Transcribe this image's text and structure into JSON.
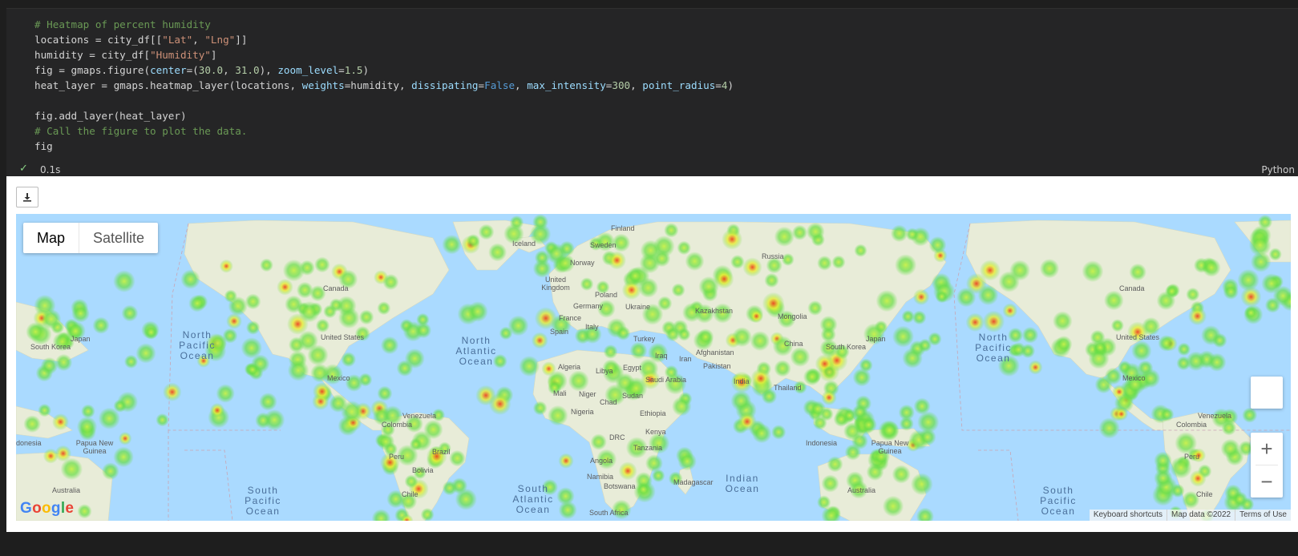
{
  "code": {
    "line1": "# Heatmap of percent humidity",
    "line2": {
      "a": "locations = city_df[[",
      "s1": "\"Lat\"",
      "b": ", ",
      "s2": "\"Lng\"",
      "c": "]]"
    },
    "line3": {
      "a": "humidity = city_df[",
      "s1": "\"Humidity\"",
      "b": "]"
    },
    "line4": {
      "a": "fig = gmaps.figure(",
      "k1": "center",
      "b": "=(",
      "n1": "30.0",
      "c": ", ",
      "n2": "31.0",
      "d": "), ",
      "k2": "zoom_level",
      "e": "=",
      "n3": "1.5",
      "f": ")"
    },
    "line5": {
      "a": "heat_layer = gmaps.heatmap_layer(locations, ",
      "k1": "weights",
      "b": "=humidity, ",
      "k2": "dissipating",
      "c": "=",
      "v1": "False",
      "d": ", ",
      "k3": "max_intensity",
      "e": "=",
      "n1": "300",
      "f": ", ",
      "k4": "point_radius",
      "g": "=",
      "n2": "4",
      "h": ")"
    },
    "line7": "fig.add_layer(heat_layer)",
    "line8": "# Call the figure to plot the data.",
    "line9": "fig"
  },
  "status": {
    "check_icon": "check-icon",
    "time": "0.1s",
    "language": "Python"
  },
  "output": {
    "download_icon": "download-icon",
    "map_type": {
      "map": "Map",
      "satellite": "Satellite"
    },
    "zoom_in": "+",
    "zoom_out": "−",
    "logo": "Google",
    "attribution": {
      "shortcuts": "Keyboard shortcuts",
      "data": "Map data ©2022",
      "terms": "Terms of Use"
    },
    "oceans": {
      "north_pacific_1": [
        "North",
        "Pacific",
        "Ocean"
      ],
      "north_atlantic": [
        "North",
        "Atlantic",
        "Ocean"
      ],
      "north_pacific_2": [
        "North",
        "Pacific",
        "Ocean"
      ],
      "south_pacific_1": [
        "South",
        "Pacific",
        "Ocean"
      ],
      "south_atlantic": [
        "South",
        "Atlantic",
        "Ocean"
      ],
      "indian": [
        "Indian",
        "Ocean"
      ],
      "south_pacific_2": [
        "South",
        "Pacific",
        "Ocean"
      ]
    },
    "countries": {
      "finland": "Finland",
      "sweden": "Sweden",
      "iceland": "Iceland",
      "norway": "Norway",
      "russia": "Russia",
      "canada_1": "Canada",
      "canada_2": "Canada",
      "united_kingdom": [
        "United",
        "Kingdom"
      ],
      "poland": "Poland",
      "germany": "Germany",
      "ukraine": "Ukraine",
      "kazakhstan": "Kazakhstan",
      "mongolia": "Mongolia",
      "france": "France",
      "spain": "Spain",
      "italy": "Italy",
      "turkey": "Turkey",
      "japan_1": "Japan",
      "japan_2": "Japan",
      "south_korea_1": "South Korea",
      "south_korea_2": "South Korea",
      "united_states_1": "United States",
      "united_states_2": "United States",
      "china": "China",
      "iraq": "Iraq",
      "iran": "Iran",
      "afghanistan": "Afghanistan",
      "pakistan": "Pakistan",
      "algeria": "Algeria",
      "libya": "Libya",
      "egypt": "Egypt",
      "saudi_arabia": "Saudi Arabia",
      "india": "India",
      "mexico_1": "Mexico",
      "mexico_2": "Mexico",
      "mali": "Mali",
      "niger": "Niger",
      "chad": "Chad",
      "sudan": "Sudan",
      "thailand": "Thailand",
      "venezuela_1": "Venezuela",
      "venezuela_2": "Venezuela",
      "nigeria": "Nigeria",
      "ethiopia": "Ethiopia",
      "colombia_1": "Colombia",
      "colombia_2": "Colombia",
      "kenya": "Kenya",
      "drc": "DRC",
      "indonesia_1": "donesia",
      "indonesia_2": "Indonesia",
      "papua_new_guinea_1": [
        "Papua New",
        "Guinea"
      ],
      "papua_new_guinea_2": [
        "Papua New",
        "Guinea"
      ],
      "tanzania": "Tanzania",
      "brazil": "Brazil",
      "peru_1": "Peru",
      "peru_2": "Peru",
      "angola": "Angola",
      "bolivia": "Bolivia",
      "namibia": "Namibia",
      "madagascar": "Madagascar",
      "botswana": "Botswana",
      "australia_1": "Australia",
      "australia_2": "Australia",
      "chile_1": "Chile",
      "chile_2": "Chile",
      "south_africa": "South Africa"
    },
    "colors": {
      "water": "#aadaff",
      "land": "#e8ecd8",
      "heat_low": "#66dd44",
      "heat_mid": "#e8ee33",
      "heat_high": "#ee4422"
    }
  }
}
